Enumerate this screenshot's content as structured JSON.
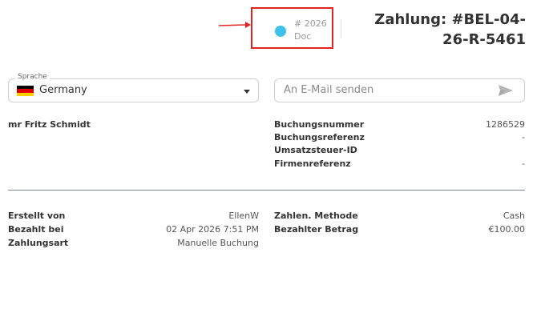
{
  "doc_badge": {
    "number": "# 2026",
    "type": "Doc",
    "dot_color": "#3fc2ea"
  },
  "title": "Zahlung: #BEL-04-26-R-5461",
  "language": {
    "legend": "Sprache",
    "value": "Germany"
  },
  "email": {
    "placeholder": "An E-Mail senden"
  },
  "customer": {
    "name": "mr Fritz Schmidt"
  },
  "booking": {
    "rows": [
      {
        "label": "Buchungsnummer",
        "value": "1286529"
      },
      {
        "label": "Buchungsreferenz",
        "value": "-"
      },
      {
        "label": "Umsatzsteuer-ID",
        "value": ""
      },
      {
        "label": "Firmenreferenz",
        "value": "-"
      }
    ]
  },
  "payment_left": {
    "rows": [
      {
        "label": "Erstellt von",
        "value": "EllenW"
      },
      {
        "label": "Bezahlt bei",
        "value": "02 Apr 2026 7:51 PM"
      },
      {
        "label": "Zahlungsart",
        "value": "Manuelle Buchung"
      }
    ]
  },
  "payment_right": {
    "rows": [
      {
        "label": "Zahlen. Methode",
        "value": "Cash"
      },
      {
        "label": "Bezahlter Betrag",
        "value": "€100.00"
      }
    ]
  }
}
